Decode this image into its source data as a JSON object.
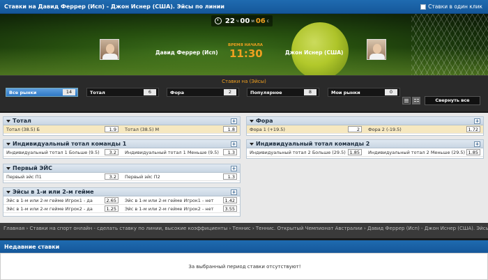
{
  "header": {
    "title": "Ставки на Давид Феррер (Исп) - Джон Иснер (США). Эйсы по линии",
    "one_click_label": "Ставки в один клик"
  },
  "scoreboard": {
    "timer_hours": "22",
    "timer_hours_unit": "ч",
    "timer_minutes": "00",
    "timer_minutes_unit": "м",
    "timer_seconds": "06",
    "timer_seconds_unit": "с",
    "player1": "Давид Феррер (Исп)",
    "player2": "Джон Иснер (США)",
    "start_label": "ВРЕМЯ НАЧАЛА",
    "start_time": "11:30"
  },
  "filter": {
    "caption": "Ставки на (Эйсы)",
    "tabs": [
      {
        "label": "Все рынки",
        "count": "14"
      },
      {
        "label": "Тотал",
        "count": "6"
      },
      {
        "label": "Фора",
        "count": "2"
      },
      {
        "label": "Популярное",
        "count": "8"
      },
      {
        "label": "Мои рынки",
        "count": "0"
      }
    ],
    "collapse_label": "Свернуть все"
  },
  "markets": {
    "total": {
      "title": "Тотал",
      "rows": [
        [
          {
            "label": "Тотал (38.5) Б",
            "odd": "1.9"
          },
          {
            "label": "Тотал (38.5) М",
            "odd": "1.8"
          }
        ]
      ]
    },
    "ind_total_1": {
      "title": "Индивидуальный тотал команды 1",
      "rows": [
        [
          {
            "label": "Индивидуальный тотал 1 Больше (9.5)",
            "odd": "3.2"
          },
          {
            "label": "Индивидуальный тотал 1 Меньше (9.5)",
            "odd": "1.3"
          }
        ]
      ]
    },
    "first_ace": {
      "title": "Первый ЭЙС",
      "rows": [
        [
          {
            "label": "Первый эйс П1",
            "odd": "3.2"
          },
          {
            "label": "Первый эйс П2",
            "odd": "1.3"
          }
        ]
      ]
    },
    "aces_games": {
      "title": "Эйсы в 1-и или 2-м гейме",
      "rows": [
        [
          {
            "label": "Эйс в 1-м или 2-м гейме Игрок1 - да",
            "odd": "2.65"
          },
          {
            "label": "Эйс в 1-м или 2-м гейме Игрок1 - нет",
            "odd": "1.42"
          }
        ],
        [
          {
            "label": "Эйс в 1-м или 2-м гейме Игрок2 - да",
            "odd": "1.25"
          },
          {
            "label": "Эйс в 1-м или 2-м гейме Игрок2 - нет",
            "odd": "3.55"
          }
        ]
      ]
    },
    "fora": {
      "title": "Фора",
      "rows": [
        [
          {
            "label": "Фора 1 (+19.5)",
            "odd": "2"
          },
          {
            "label": "Фора 2 (-19.5)",
            "odd": "1.72"
          }
        ]
      ]
    },
    "ind_total_2": {
      "title": "Индивидуальный тотал команды 2",
      "rows": [
        [
          {
            "label": "Индивидуальный тотал 2 Больше (29.5)",
            "odd": "1.85"
          },
          {
            "label": "Индивидуальный тотал 2 Меньше (29.5)",
            "odd": "1.85"
          }
        ]
      ]
    }
  },
  "breadcrumbs": "Главная › Ставки на спорт онлайн - сделать ставку по линии, высокие коэффициенты › Теннис › Теннис. Открытый Чемпионат Австралии › Давид Феррер (Исп) - Джон Иснер (США). Эйсы",
  "recent": {
    "title": "Недавние ставки",
    "empty_message": "За выбранный период ставки отсутствуют!"
  }
}
